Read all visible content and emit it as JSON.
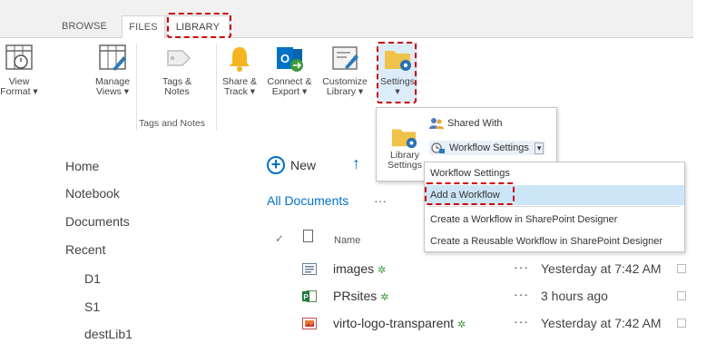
{
  "ribbon": {
    "tabs": [
      {
        "label": "BROWSE"
      },
      {
        "label": "FILES"
      },
      {
        "label": "LIBRARY"
      }
    ],
    "buttons": {
      "view_format": "View\nFormat ▾",
      "manage_views": "Manage\nViews ▾",
      "tags_notes": "Tags &\nNotes",
      "share_track": "Share &\nTrack ▾",
      "connect_export": "Connect &\nExport ▾",
      "customize_library": "Customize\nLibrary ▾",
      "settings": "Settings",
      "settings_caret": "▾"
    },
    "group_labels": {
      "tags_and_notes": "Tags and Notes"
    }
  },
  "settings_menu": {
    "library_settings": "Library\nSettings",
    "shared_with": "Shared With",
    "workflow_settings": "Workflow Settings",
    "caret": "▾"
  },
  "workflow_submenu": {
    "items": [
      {
        "label": "Workflow Settings"
      },
      {
        "label": "Add a Workflow"
      },
      {
        "label": "Create a Workflow in SharePoint Designer"
      },
      {
        "label": "Create a Reusable Workflow in SharePoint Designer"
      }
    ]
  },
  "left_nav": {
    "items": [
      {
        "label": "Home"
      },
      {
        "label": "Notebook"
      },
      {
        "label": "Documents"
      },
      {
        "label": "Recent"
      }
    ],
    "sub_items": [
      {
        "label": "D1"
      },
      {
        "label": "S1"
      },
      {
        "label": "destLib1"
      }
    ]
  },
  "list": {
    "new_label": "New",
    "view_name": "All Documents",
    "view_more": "···",
    "check_mark": "✓",
    "columns": {
      "name": "Name"
    },
    "rows": [
      {
        "name": "images",
        "modified": "Yesterday at 7:42 AM",
        "dots": "···",
        "file_type": "image-library-icon"
      },
      {
        "name": "PRsites",
        "modified": "3 hours ago",
        "dots": "···",
        "file_type": "publisher-icon"
      },
      {
        "name": "virto-logo-transparent",
        "modified": "Yesterday at 7:42 AM",
        "dots": "···",
        "file_type": "image-file-icon"
      }
    ],
    "new_badge": "✲"
  },
  "colors": {
    "accent": "#0072c6",
    "highlight": "#cc0000",
    "selected": "#cde6f7"
  }
}
